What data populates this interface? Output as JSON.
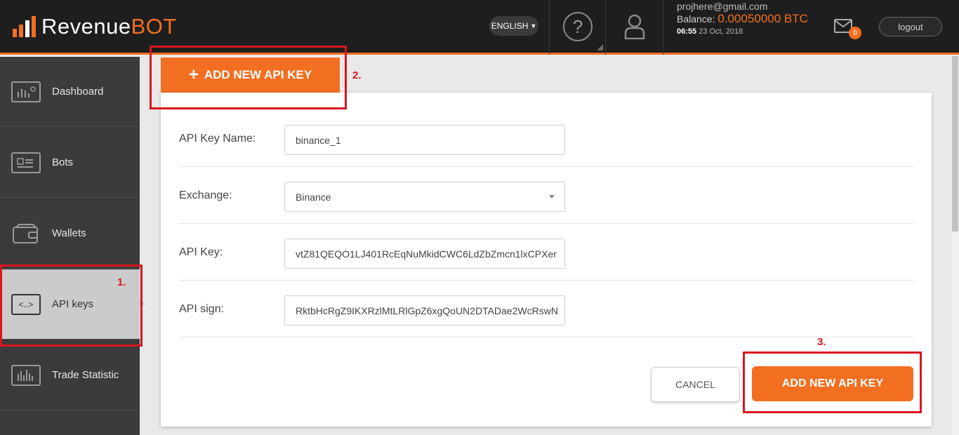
{
  "header": {
    "logo_text": "Revenue",
    "logo_accent": "BOT",
    "language": "ENGLISH",
    "help_symbol": "?",
    "user_email": "projhere@gmail.com",
    "balance_label": "Balance:",
    "balance_value": "0.00050000 BTC",
    "time": "06:55",
    "date": "23 Oct, 2018",
    "notifications_count": "0",
    "logout_label": "logout"
  },
  "sidebar": {
    "items": [
      {
        "label": "Dashboard",
        "icon": "dashboard-icon"
      },
      {
        "label": "Bots",
        "icon": "bot-icon"
      },
      {
        "label": "Wallets",
        "icon": "wallet-icon"
      },
      {
        "label": "API keys",
        "icon": "code-icon",
        "icon_glyph": "<..>"
      },
      {
        "label": "Trade Statistic",
        "icon": "bar-chart-icon"
      }
    ],
    "active_index": 3
  },
  "main": {
    "tab_label": "ADD NEW API KEY",
    "form": {
      "name_label": "API Key Name:",
      "name_value": "binance_1",
      "exchange_label": "Exchange:",
      "exchange_value": "Binance",
      "api_key_label": "API Key:",
      "api_key_value": "vtZ81QEQO1LJ401RcEqNuMkidCWC6LdZbZmcn1lxCPXer",
      "api_sign_label": "API sign:",
      "api_sign_value": "RktbHcRgZ9IKXRzlMtLRlGpZ6xgQoUN2DTADae2WcRswN"
    },
    "cancel_label": "CANCEL",
    "submit_label": "ADD NEW API KEY"
  },
  "annotations": {
    "step1": "1.",
    "step2": "2.",
    "step3": "3."
  },
  "colors": {
    "accent": "#f26f21",
    "annotation": "#d9161e",
    "topbar": "#1e1e1e",
    "sidebar": "#3b3b3b"
  }
}
